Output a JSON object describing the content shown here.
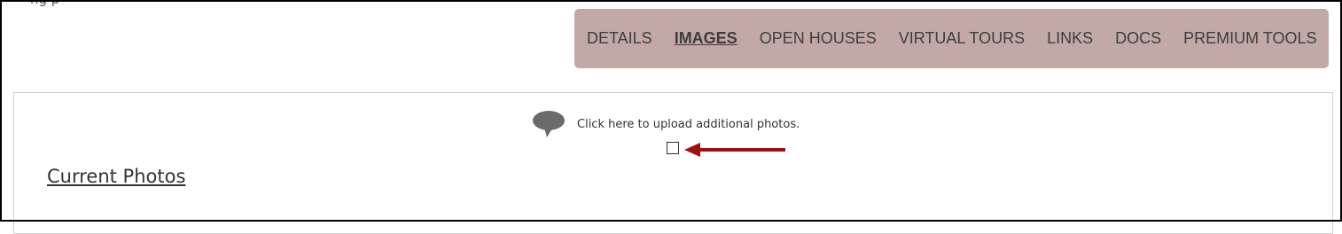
{
  "header": {
    "clipped_text": "ng     p"
  },
  "tabs": [
    {
      "label": "DETAILS",
      "active": false
    },
    {
      "label": "IMAGES",
      "active": true
    },
    {
      "label": "OPEN HOUSES",
      "active": false
    },
    {
      "label": "VIRTUAL TOURS",
      "active": false
    },
    {
      "label": "LINKS",
      "active": false
    },
    {
      "label": "DOCS",
      "active": false
    },
    {
      "label": "PREMIUM TOOLS",
      "active": false
    }
  ],
  "colors": {
    "tab_bar": "#c2a9a8",
    "arrow": "#a50e0e",
    "icon": "#6b6b6b"
  },
  "upload": {
    "icon": "speech-bubble-icon",
    "text": "Click here to upload additional photos.",
    "checked": false
  },
  "annotation": {
    "icon": "arrow-left-icon"
  },
  "section": {
    "title": "Current Photos"
  }
}
